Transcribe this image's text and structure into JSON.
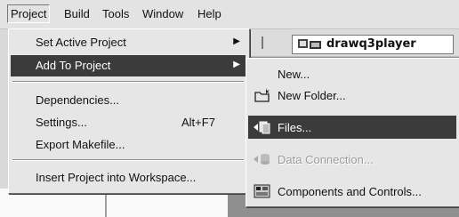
{
  "menubar": {
    "items": [
      {
        "label": "Project",
        "active": true
      },
      {
        "label": "Build"
      },
      {
        "label": "Tools"
      },
      {
        "label": "Window"
      },
      {
        "label": "Help"
      }
    ]
  },
  "toolbar": {
    "combo_value": "drawq3player"
  },
  "project_menu": {
    "items": [
      {
        "label": "Set Active Project",
        "submenu": true
      },
      {
        "label": "Add To Project",
        "submenu": true,
        "highlighted": true
      },
      {
        "label": "Dependencies..."
      },
      {
        "label": "Settings...",
        "accel": "Alt+F7"
      },
      {
        "label": "Export Makefile..."
      },
      {
        "label": "Insert Project into Workspace..."
      }
    ]
  },
  "add_to_project_submenu": {
    "items": [
      {
        "label": "New...",
        "icon": "none"
      },
      {
        "label": "New Folder...",
        "icon": "new-folder-icon"
      },
      {
        "label": "Files...",
        "icon": "add-files-icon",
        "highlighted": true
      },
      {
        "label": "Data Connection...",
        "icon": "data-connection-icon",
        "disabled": true
      },
      {
        "label": "Components and Controls...",
        "icon": "components-icon"
      }
    ]
  },
  "colors": {
    "highlight": "#3b3b3b",
    "menu_bg": "#e6e6e6",
    "disabled_text": "#9c9c9c"
  }
}
